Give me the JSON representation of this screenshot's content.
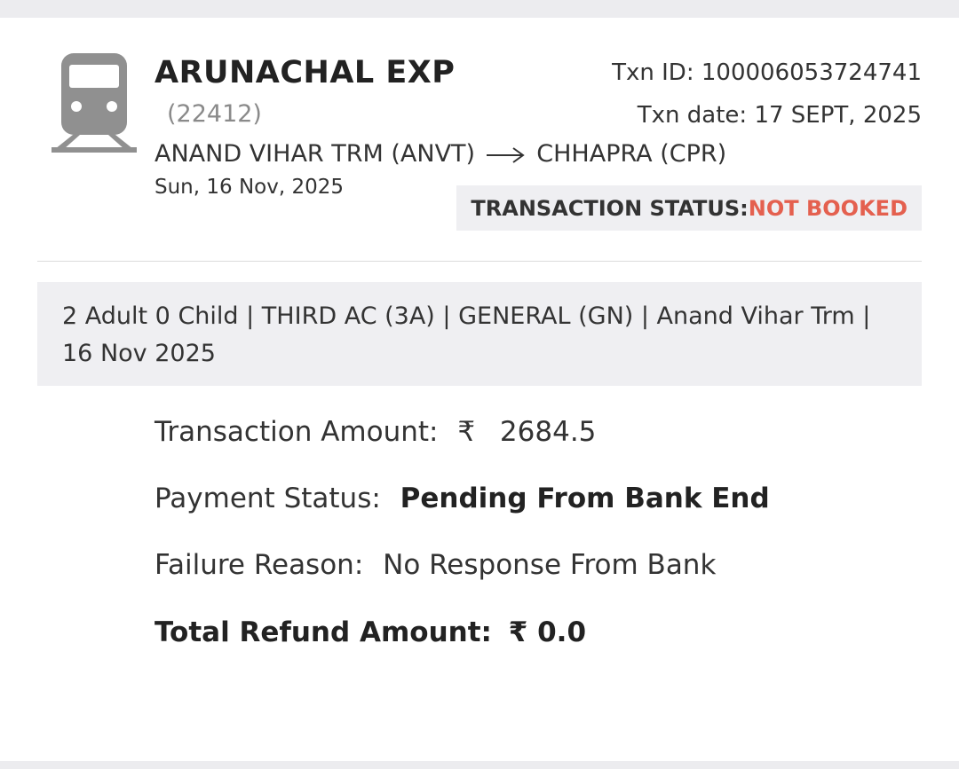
{
  "train": {
    "icon": "train-icon",
    "name": "ARUNACHAL EXP",
    "number": "(22412)",
    "from": "ANAND VIHAR TRM (ANVT)",
    "to": "CHHAPRA (CPR)",
    "journey_date": "Sun, 16 Nov, 2025"
  },
  "transaction": {
    "id_label": "Txn ID: ",
    "id": "100006053724741",
    "date_label": "Txn date: ",
    "date": "17 SEPT, 2025",
    "status_label": "TRANSACTION STATUS:",
    "status": "NOT BOOKED",
    "status_color": "#e4604f"
  },
  "summary": "2 Adult 0 Child  | THIRD AC (3A) | GENERAL (GN) | Anand Vihar Trm | 16 Nov 2025",
  "details": {
    "amount_label": "Transaction Amount:",
    "currency": "₹",
    "amount": "2684.5",
    "payment_status_label": "Payment Status:",
    "payment_status": "Pending From Bank End",
    "failure_reason_label": "Failure Reason:",
    "failure_reason": "No Response From Bank",
    "refund_label": "Total Refund Amount:",
    "refund_amount": "₹ 0.0"
  }
}
